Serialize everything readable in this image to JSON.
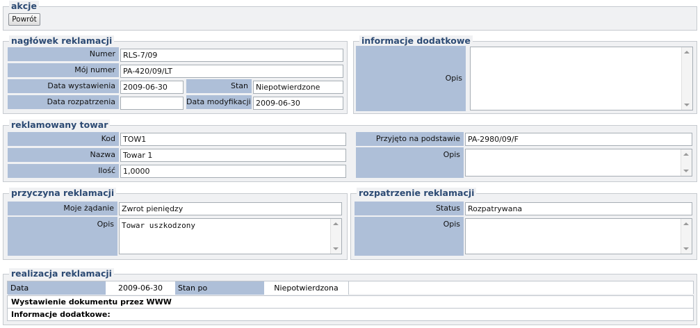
{
  "akcje": {
    "legend": "akcje",
    "back_button": "Powrót"
  },
  "naglowek": {
    "legend": "nagłówek reklamacji",
    "numer_label": "Numer",
    "numer_value": "RLS-7/09",
    "moj_numer_label": "Mój numer",
    "moj_numer_value": "PA-420/09/LT",
    "data_wystawienia_label": "Data wystawienia",
    "data_wystawienia_value": "2009-06-30",
    "stan_label": "Stan",
    "stan_value": "Niepotwierdzone",
    "data_rozpatrzenia_label": "Data rozpatrzenia",
    "data_rozpatrzenia_value": "",
    "data_modyfikacji_label": "Data modyfikacji",
    "data_modyfikacji_value": "2009-06-30"
  },
  "informacje": {
    "legend": "informacje dodatkowe",
    "opis_label": "Opis",
    "opis_value": ""
  },
  "towar": {
    "legend": "reklamowany towar",
    "kod_label": "Kod",
    "kod_value": "TOW1",
    "nazwa_label": "Nazwa",
    "nazwa_value": "Towar 1",
    "ilosc_label": "Ilość",
    "ilosc_value": "1,0000",
    "przyjeto_label": "Przyjęto na podstawie",
    "przyjeto_value": "PA-2980/09/F",
    "opis_label": "Opis",
    "opis_value": ""
  },
  "przyczyna": {
    "legend": "przyczyna reklamacji",
    "zadanie_label": "Moje żądanie",
    "zadanie_value": "Zwrot pieniędzy",
    "opis_label": "Opis",
    "opis_value": "Towar uszkodzony"
  },
  "rozpatrzenie": {
    "legend": "rozpatrzenie reklamacji",
    "status_label": "Status",
    "status_value": "Rozpatrywana",
    "opis_label": "Opis",
    "opis_value": ""
  },
  "realizacja": {
    "legend": "realizacja reklamacji",
    "data_label": "Data",
    "data_value": "2009-06-30",
    "stan_po_label": "Stan po",
    "stan_po_value": "Niepotwierdzona",
    "row1": "Wystawienie dokumentu przez WWW",
    "row2": "Informacje dodatkowe:"
  }
}
